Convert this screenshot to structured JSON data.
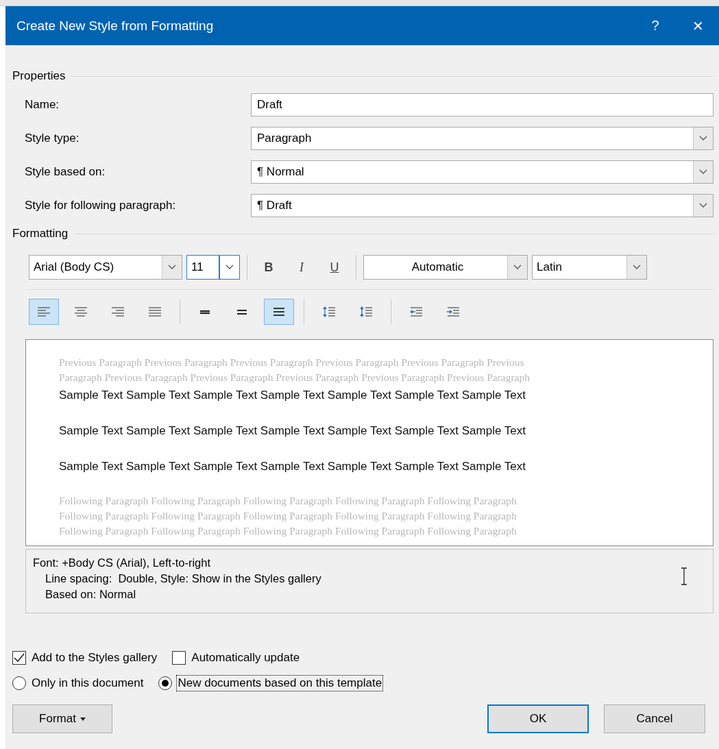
{
  "window": {
    "title": "Create New Style from Formatting",
    "help": "?",
    "close": "✕"
  },
  "properties": {
    "heading": "Properties",
    "fields": [
      {
        "label": "Name:",
        "kind": "text",
        "value": "Draft"
      },
      {
        "label": "Style type:",
        "kind": "dropdown",
        "value": "Paragraph"
      },
      {
        "label": "Style based on:",
        "kind": "dropdown",
        "value": "¶ Normal"
      },
      {
        "label": "Style for following paragraph:",
        "kind": "dropdown",
        "value": "¶ Draft"
      }
    ]
  },
  "formatting": {
    "heading": "Formatting",
    "font": {
      "value": "Arial (Body CS)"
    },
    "size": {
      "value": "11",
      "focused": true
    },
    "styles": [
      {
        "label": "B",
        "kind": "bold",
        "selected": false
      },
      {
        "label": "I",
        "kind": "italic",
        "selected": false
      },
      {
        "label": "U",
        "kind": "underline",
        "selected": false
      }
    ],
    "color": {
      "value": "Automatic"
    },
    "script": {
      "value": "Latin"
    },
    "paragraph_groups": [
      {
        "buttons": [
          {
            "kind": "align-left",
            "selected": true
          },
          {
            "kind": "align-center",
            "selected": false
          },
          {
            "kind": "align-right",
            "selected": false
          },
          {
            "kind": "justify",
            "selected": false
          }
        ]
      },
      {
        "buttons": [
          {
            "kind": "single-spacing",
            "selected": false
          },
          {
            "kind": "one-half-spacing",
            "selected": false
          },
          {
            "kind": "double-spacing",
            "selected": true
          }
        ]
      },
      {
        "buttons": [
          {
            "kind": "space-before-up",
            "selected": false
          },
          {
            "kind": "space-before-down",
            "selected": false
          }
        ]
      },
      {
        "buttons": [
          {
            "kind": "indent-decrease",
            "selected": false
          },
          {
            "kind": "indent-increase",
            "selected": false
          }
        ]
      }
    ]
  },
  "preview": {
    "previous": [
      "Previous Paragraph Previous Paragraph Previous Paragraph Previous Paragraph Previous Paragraph Previous",
      "Paragraph Previous Paragraph Previous Paragraph Previous Paragraph Previous Paragraph Previous Paragraph"
    ],
    "sample": [
      "Sample Text Sample Text Sample Text Sample Text Sample Text Sample Text Sample Text",
      "Sample Text Sample Text Sample Text Sample Text Sample Text Sample Text Sample Text",
      "Sample Text Sample Text Sample Text Sample Text Sample Text Sample Text Sample Text"
    ],
    "following": [
      "Following Paragraph Following Paragraph Following Paragraph Following Paragraph Following Paragraph",
      "Following Paragraph Following Paragraph Following Paragraph Following Paragraph Following Paragraph",
      "Following Paragraph Following Paragraph Following Paragraph Following Paragraph Following Paragraph"
    ]
  },
  "description": [
    "Font: +Body CS (Arial), Left-to-right",
    "Line spacing:  Double, Style: Show in the Styles gallery",
    "Based on: Normal"
  ],
  "checkboxes": [
    {
      "label": "Add to the Styles gallery",
      "checked": true
    },
    {
      "label": "Automatically update",
      "checked": false
    }
  ],
  "radios": [
    {
      "label": "Only in this document",
      "selected": false,
      "focused": false
    },
    {
      "label": "New documents based on this template",
      "selected": true,
      "focused": true
    }
  ],
  "buttons": [
    {
      "label": "Format",
      "kind": "menu"
    },
    {
      "label": "OK",
      "kind": "default"
    },
    {
      "label": "Cancel",
      "kind": "normal"
    }
  ]
}
